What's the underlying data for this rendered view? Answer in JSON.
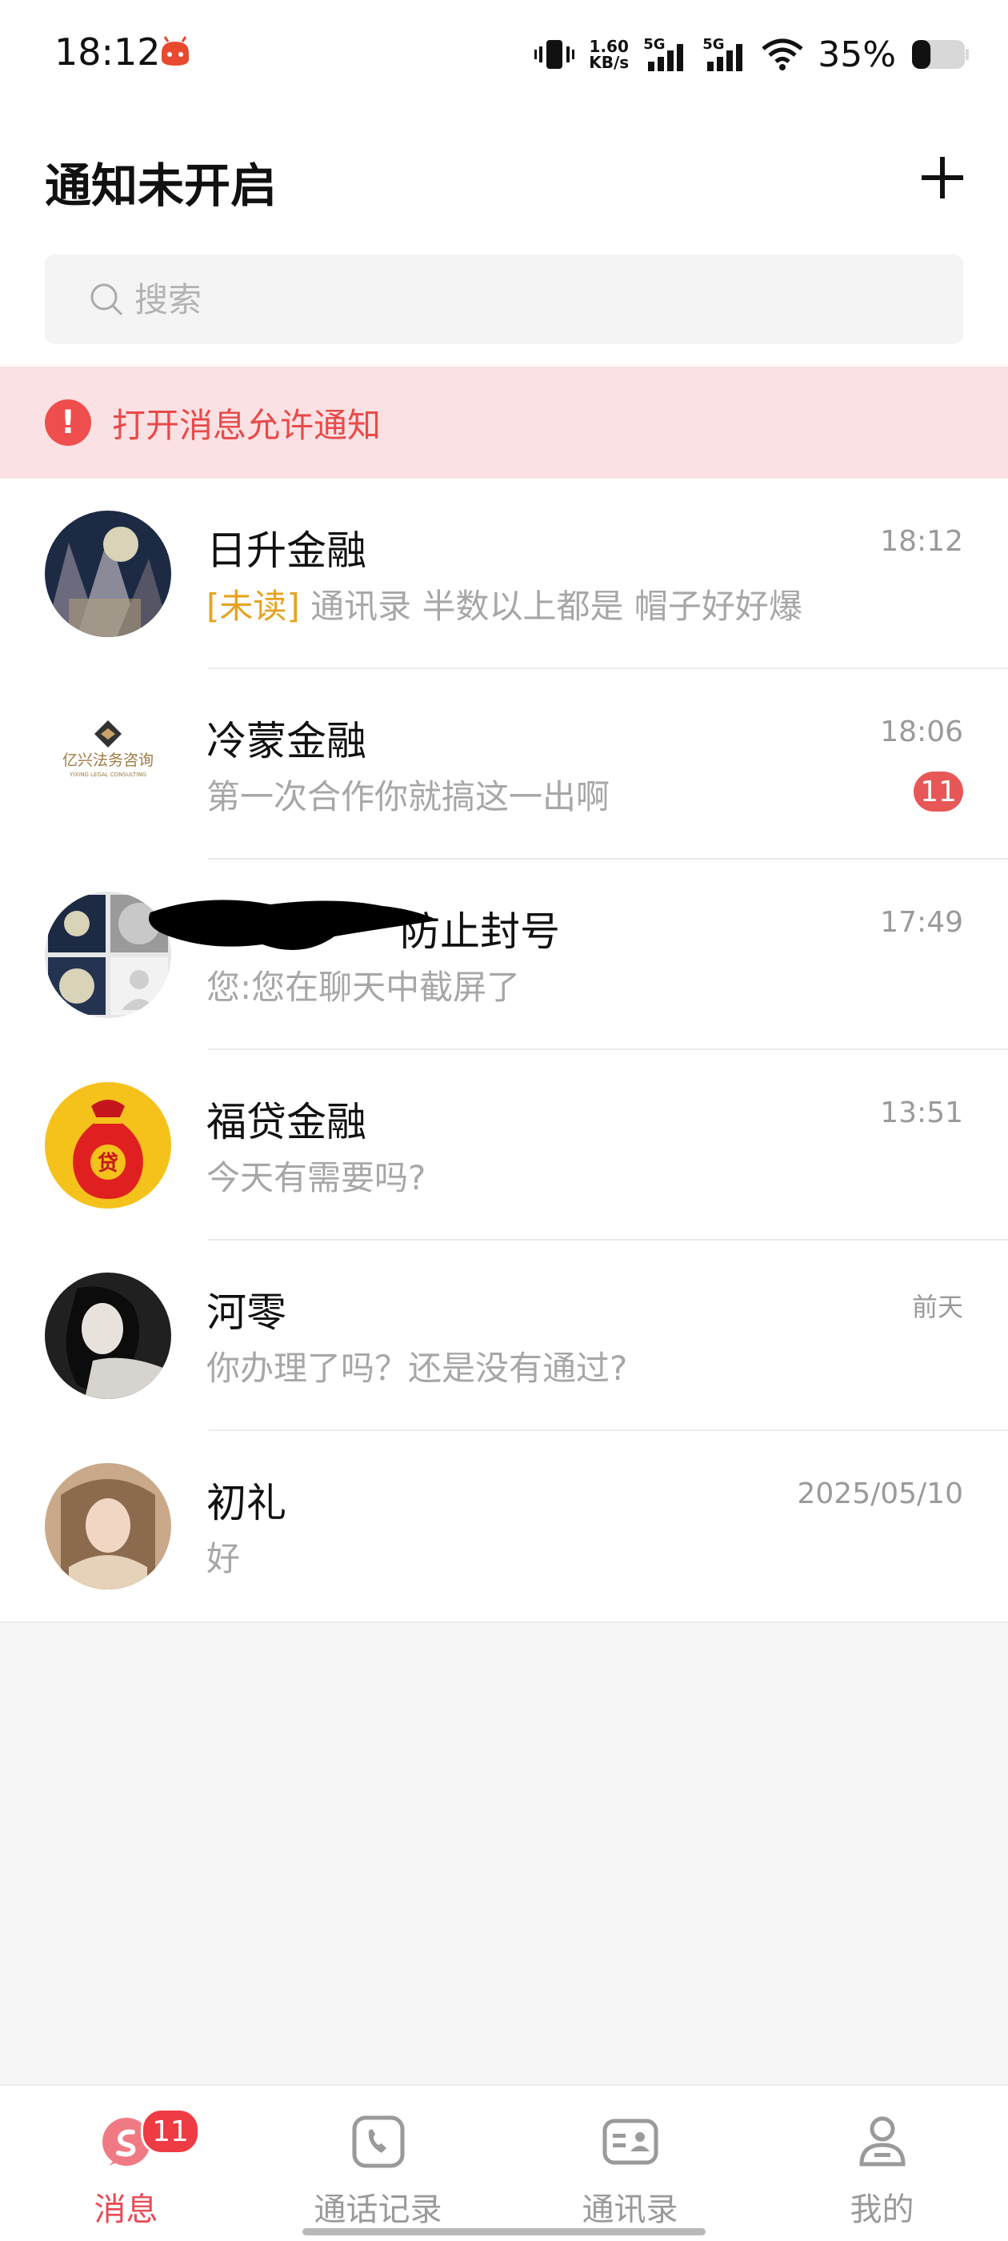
{
  "status_bar": {
    "time": "18:12",
    "net_speed_value": "1.60",
    "net_speed_unit": "KB/s",
    "sim1_label": "5G",
    "sim2_label": "5G",
    "battery_percent": "35%",
    "battery_level": 0.35
  },
  "header": {
    "title": "通知未开启",
    "add_icon": "plus-icon"
  },
  "search": {
    "placeholder": "搜索",
    "value": ""
  },
  "banner": {
    "text": "打开消息允许通知",
    "icon": "exclamation-icon"
  },
  "chats": [
    {
      "name": "日升金融",
      "time": "18:12",
      "tag": "[未读]",
      "preview": "通讯录  半数以上都是 帽子好好爆",
      "unread": ""
    },
    {
      "name": "冷蒙金融",
      "time": "18:06",
      "tag": "",
      "preview": "第一次合作你就搞这一出啊",
      "unread": "11",
      "avatar_text_cn": "亿兴法务咨询",
      "avatar_text_en": "YIXING LEGAL CONSULTING"
    },
    {
      "name": "防止封号",
      "time": "17:49",
      "tag": "",
      "preview": "您:您在聊天中截屏了",
      "unread": ""
    },
    {
      "name": "福贷金融",
      "time": "13:51",
      "tag": "",
      "preview": "今天有需要吗?",
      "unread": "",
      "avatar_text": "贷"
    },
    {
      "name": "河零",
      "time": "前天",
      "tag": "",
      "preview": "你办理了吗？还是没有通过?",
      "unread": ""
    },
    {
      "name": "初礼",
      "time": "2025/05/10",
      "tag": "",
      "preview": "好",
      "unread": ""
    }
  ],
  "nav": {
    "items": [
      {
        "label": "消息",
        "icon": "message-icon",
        "badge": "11"
      },
      {
        "label": "通话记录",
        "icon": "phone-icon"
      },
      {
        "label": "通讯录",
        "icon": "contacts-icon"
      },
      {
        "label": "我的",
        "icon": "profile-icon"
      }
    ]
  },
  "colors": {
    "accent": "#e84a55",
    "banner_bg": "#fbe1e3",
    "unread_tag": "#e6a31e",
    "badge": "#e85757"
  }
}
